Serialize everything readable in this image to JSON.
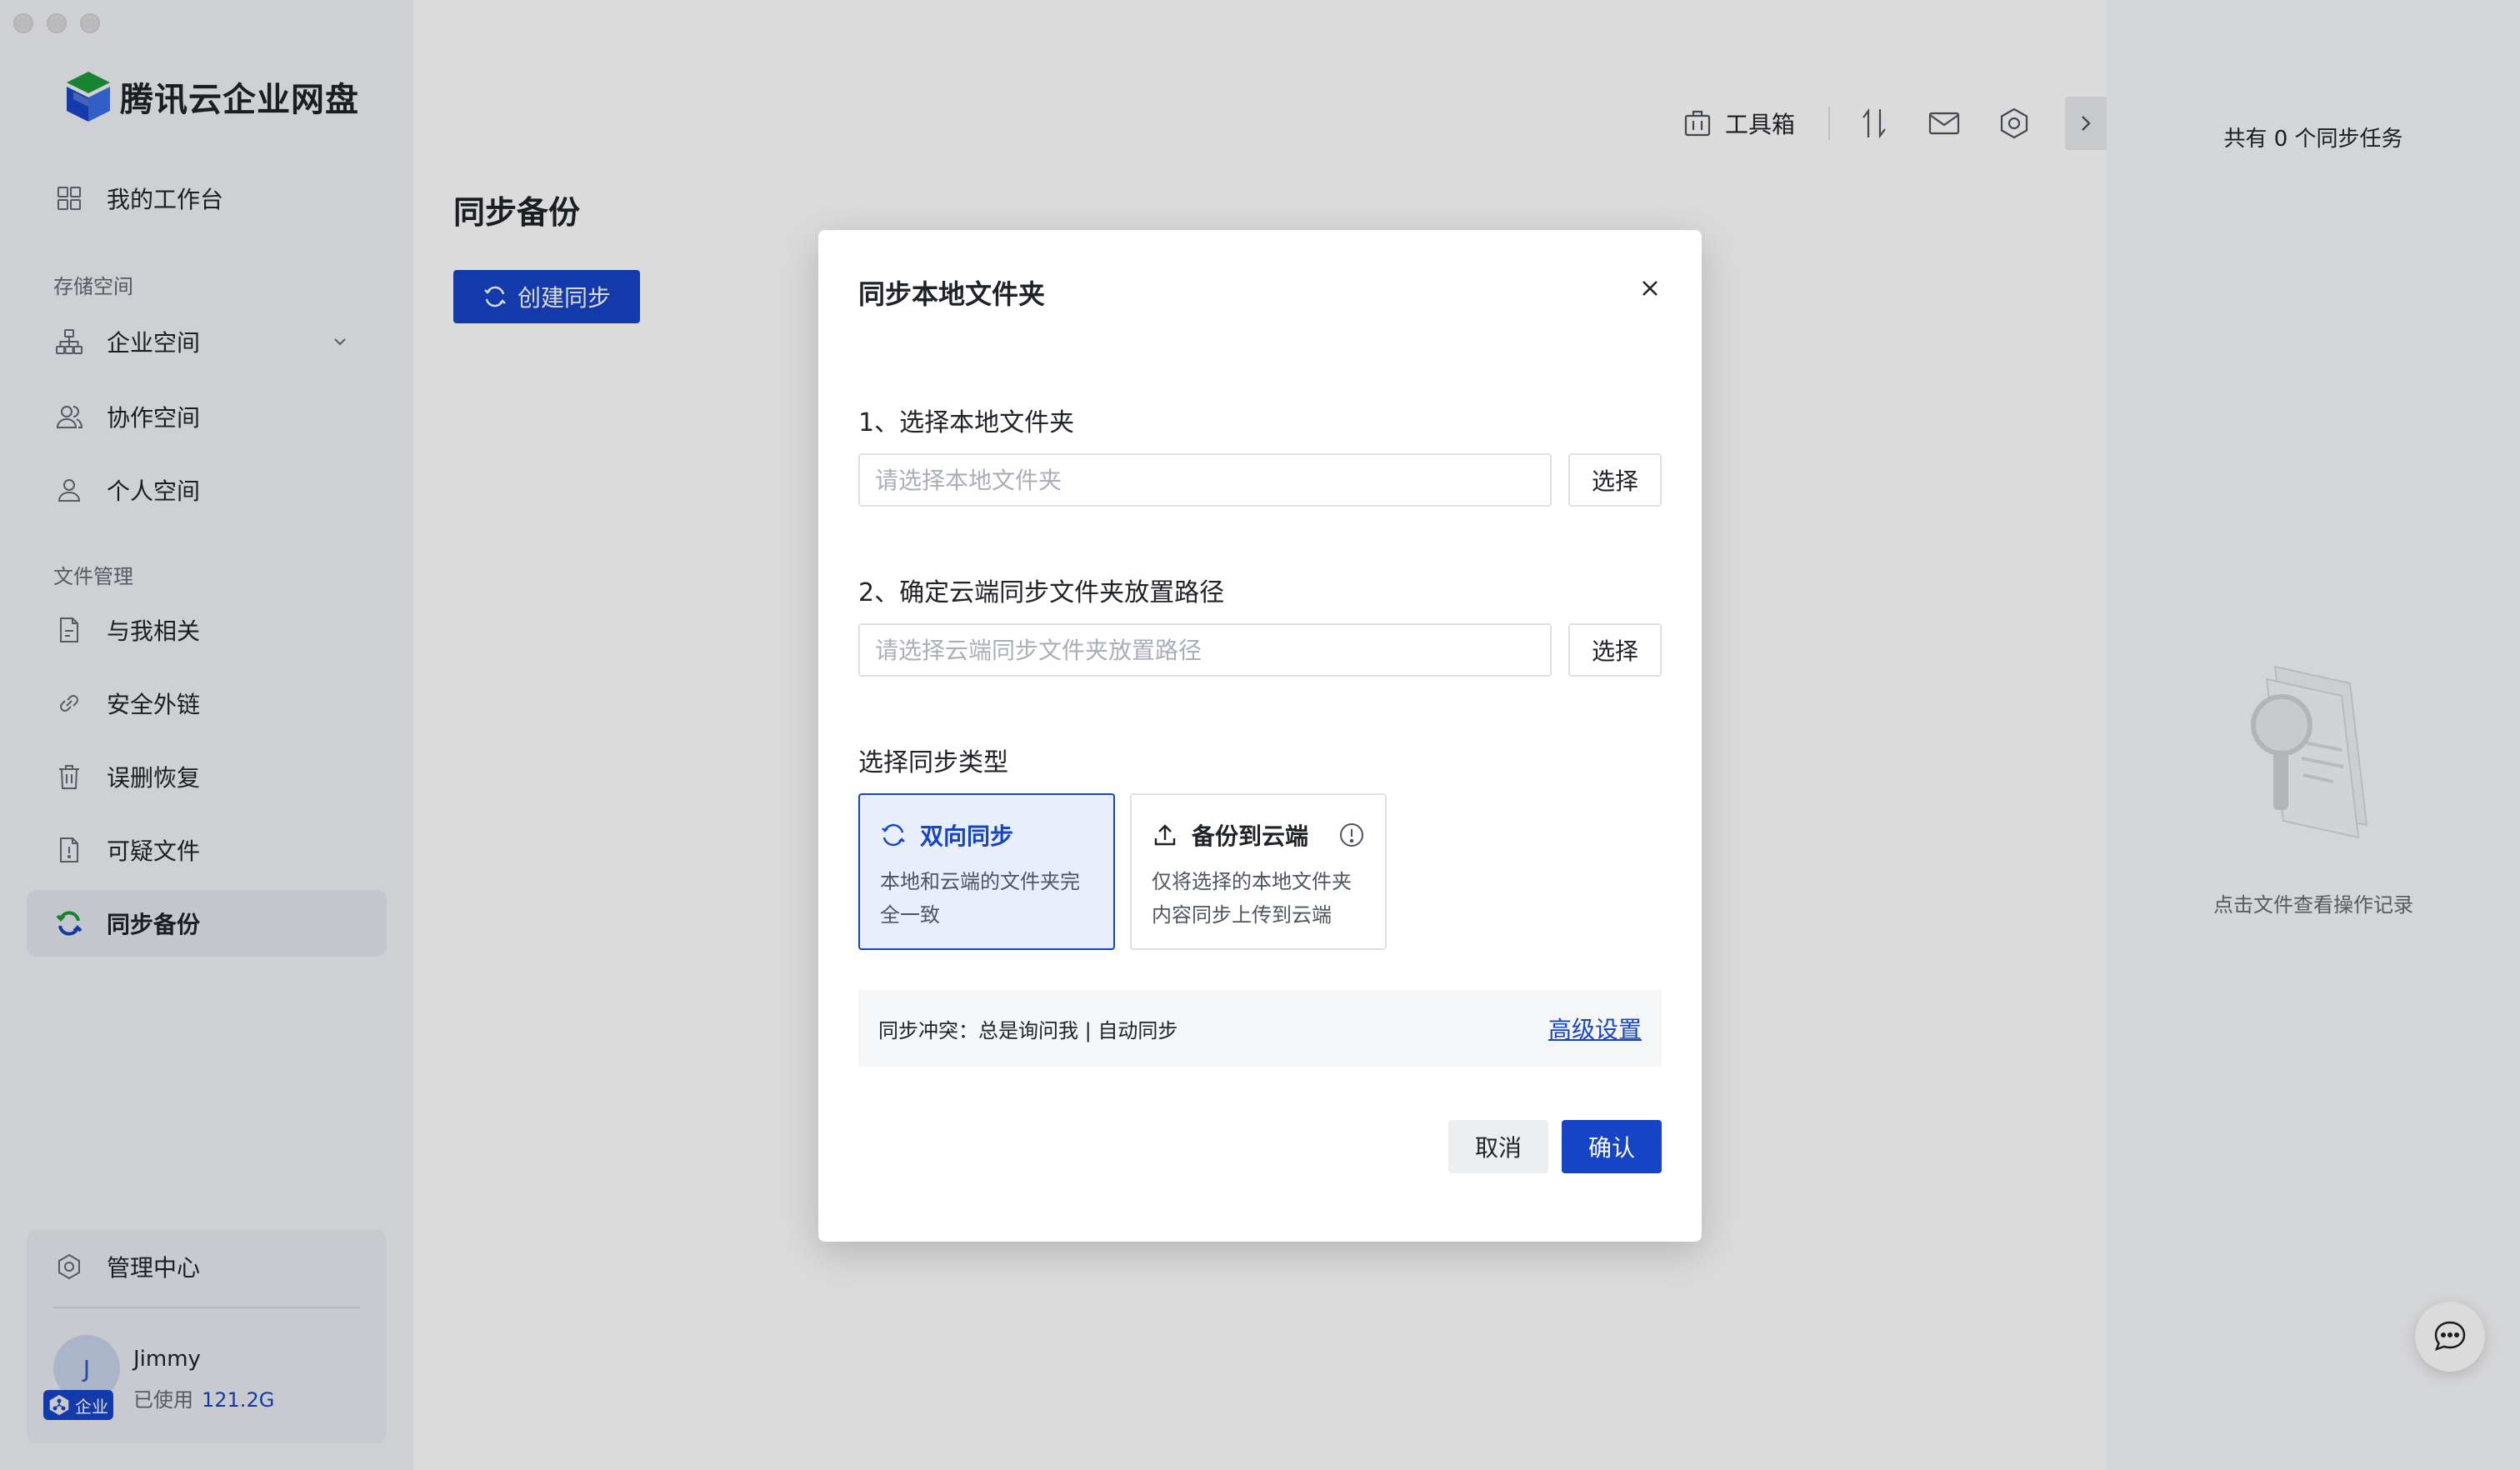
{
  "app": {
    "name": "腾讯云企业网盘"
  },
  "sidebar": {
    "workbench": "我的工作台",
    "section_storage": "存储空间",
    "storage_items": [
      "企业空间",
      "协作空间",
      "个人空间"
    ],
    "section_files": "文件管理",
    "file_items": [
      "与我相关",
      "安全外链",
      "误删恢复",
      "可疑文件",
      "同步备份"
    ],
    "active_item": "同步备份",
    "admin_center": "管理中心",
    "user": {
      "initial": "J",
      "name": "Jimmy",
      "badge": "企业",
      "usage_label": "已使用",
      "usage_value": "121.2G"
    }
  },
  "toolbar": {
    "toolbox_label": "工具箱"
  },
  "main": {
    "title": "同步备份",
    "create_button": "创建同步"
  },
  "right_panel": {
    "task_count_text": "共有 0 个同步任务",
    "hint": "点击文件查看操作记录"
  },
  "dialog": {
    "title": "同步本地文件夹",
    "step1_label": "1、选择本地文件夹",
    "step1_placeholder": "请选择本地文件夹",
    "step1_button": "选择",
    "step2_label": "2、确定云端同步文件夹放置路径",
    "step2_placeholder": "请选择云端同步文件夹放置路径",
    "step2_button": "选择",
    "type_label": "选择同步类型",
    "types": [
      {
        "name": "双向同步",
        "desc": "本地和云端的文件夹完全一致",
        "selected": true
      },
      {
        "name": "备份到云端",
        "desc": "仅将选择的本地文件夹内容同步上传到云端",
        "selected": false
      }
    ],
    "conflict_text": "同步冲突：总是询问我 | 自动同步",
    "advanced_link": "高级设置",
    "cancel": "取消",
    "confirm": "确认"
  },
  "colors": {
    "accent": "#1644c6",
    "accent_light": "#e8eefc"
  },
  "icons": [
    "workbench-icon",
    "org-icon",
    "chevron-down-icon",
    "team-icon",
    "person-icon",
    "document-icon",
    "link-icon",
    "trash-icon",
    "suspicious-file-icon",
    "sync-icon",
    "admin-icon",
    "toolbox-icon",
    "transfer-icon",
    "mail-icon",
    "settings-icon",
    "chevron-right-icon",
    "close-icon",
    "upload-icon",
    "info-icon",
    "chat-icon"
  ]
}
